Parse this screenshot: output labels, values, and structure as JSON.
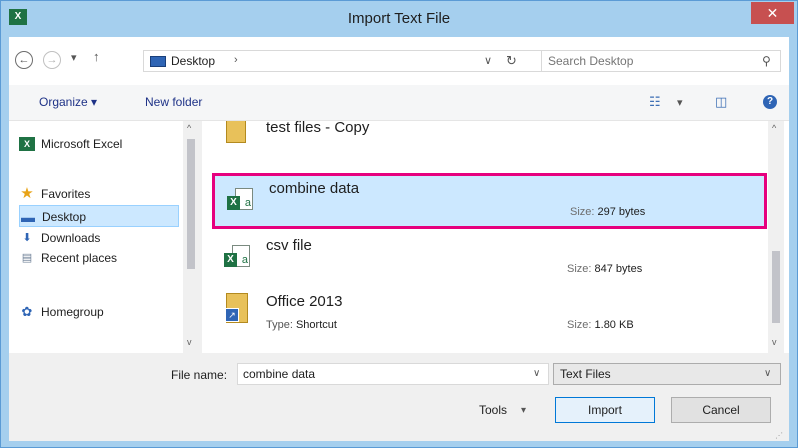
{
  "window": {
    "title": "Import Text File",
    "app_icon_text": "X",
    "close_label": "✕"
  },
  "navbar": {
    "back_glyph": "←",
    "forward_glyph": "→",
    "recent_glyph": "▾",
    "up_glyph": "↑",
    "address_segments": [
      "Desktop"
    ],
    "address_separator": "›",
    "address_dropdown_glyph": "∨",
    "refresh_glyph": "↻",
    "search_placeholder": "Search Desktop",
    "search_glyph": "⚲"
  },
  "toolbar": {
    "organize_label": "Organize ▾",
    "new_folder_label": "New folder",
    "view_glyph": "☷",
    "view_dropdown_glyph": "▾",
    "preview_glyph": "◫",
    "help_glyph": "?"
  },
  "nav_pane": {
    "items": [
      {
        "label": "Microsoft Excel",
        "icon": "excel-icon",
        "glyph": "X"
      },
      {
        "label": "Favorites",
        "icon": "star-icon",
        "glyph": "★"
      },
      {
        "label": "Desktop",
        "icon": "desktop-icon",
        "glyph": "▬"
      },
      {
        "label": "Downloads",
        "icon": "downloads-icon",
        "glyph": "⬇"
      },
      {
        "label": "Recent places",
        "icon": "recent-places-icon",
        "glyph": "▤"
      },
      {
        "label": "Homegroup",
        "icon": "homegroup-icon",
        "glyph": "✿"
      }
    ],
    "scroll_up_glyph": "^",
    "scroll_down_glyph": "v"
  },
  "files": [
    {
      "name": "test files - Copy",
      "icon": "folder-icon",
      "type_label": "",
      "type_value": "",
      "size_label": "",
      "size_value": ""
    },
    {
      "name": "combine data",
      "icon": "excel-file-icon",
      "type_label": "",
      "type_value": "",
      "size_label": "Size: ",
      "size_value": "297 bytes"
    },
    {
      "name": "csv file",
      "icon": "excel-file-icon",
      "type_label": "",
      "type_value": "",
      "size_label": "Size: ",
      "size_value": "847 bytes"
    },
    {
      "name": "Office 2013",
      "icon": "shortcut-icon",
      "type_label": "Type: ",
      "type_value": "Shortcut",
      "size_label": "Size: ",
      "size_value": "1.80 KB"
    }
  ],
  "excel_badge_letter": "a",
  "shortcut_arrow_glyph": "↗",
  "bottom": {
    "file_name_label": "File name:",
    "file_name_value": "combine data",
    "file_name_dropdown_glyph": "∨",
    "filter_value": "Text Files",
    "filter_dropdown_glyph": "∨",
    "tools_label": "Tools",
    "tools_dropdown_glyph": "▾",
    "import_label": "Import",
    "cancel_label": "Cancel",
    "grip_glyph": "⋰"
  },
  "colors": {
    "accent": "#0078d7",
    "selection": "#cce8ff",
    "highlight_border": "#e6007e",
    "excel_green": "#1f7244"
  }
}
